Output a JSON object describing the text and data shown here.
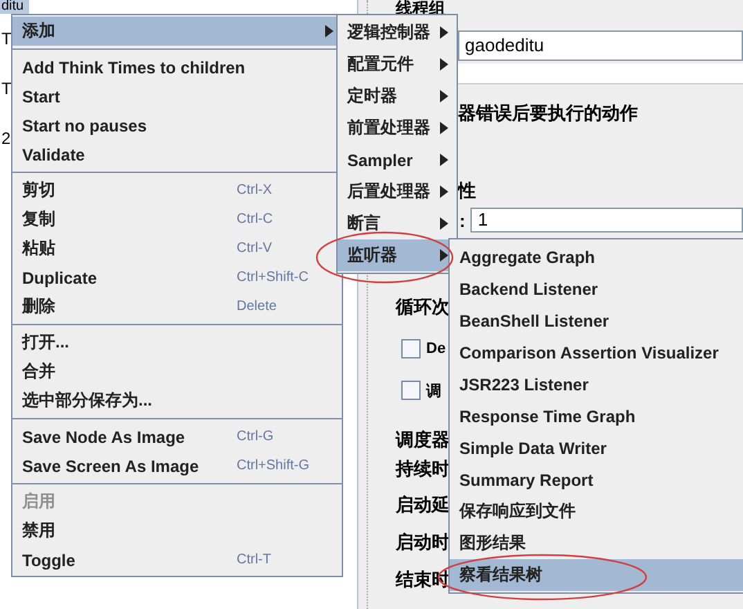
{
  "tree": {
    "top_fragment": "ditu",
    "fragments": [
      "T",
      "T",
      "2"
    ]
  },
  "panel": {
    "title": "线程组",
    "name_value": "gaodeditu",
    "error_section": "器错误后要执行的动作",
    "props_section": "性",
    "threads_label": ":",
    "threads_value": "1",
    "loop_label": "循环次",
    "checkboxes": [
      {
        "label": "De",
        "checked": false
      },
      {
        "label": "调",
        "checked": false
      }
    ],
    "scheduler_title": "调度器",
    "scheduler_labels": [
      "持续时",
      "启动延",
      "启动时",
      "结束时"
    ]
  },
  "context_menu": [
    {
      "kind": "item",
      "label": "添加",
      "submenu": true,
      "selected": true,
      "disabled": false
    },
    {
      "kind": "separator"
    },
    {
      "kind": "item",
      "label": "Add Think Times to children",
      "selected": false,
      "disabled": false
    },
    {
      "kind": "item",
      "label": "Start",
      "selected": false,
      "disabled": false
    },
    {
      "kind": "item",
      "label": "Start no pauses",
      "selected": false,
      "disabled": false
    },
    {
      "kind": "item",
      "label": "Validate",
      "selected": false,
      "disabled": false
    },
    {
      "kind": "separator"
    },
    {
      "kind": "item",
      "label": "剪切",
      "shortcut": "Ctrl-X",
      "selected": false,
      "disabled": false
    },
    {
      "kind": "item",
      "label": "复制",
      "shortcut": "Ctrl-C",
      "selected": false,
      "disabled": false
    },
    {
      "kind": "item",
      "label": "粘贴",
      "shortcut": "Ctrl-V",
      "selected": false,
      "disabled": false
    },
    {
      "kind": "item",
      "label": "Duplicate",
      "shortcut": "Ctrl+Shift-C",
      "selected": false,
      "disabled": false
    },
    {
      "kind": "item",
      "label": "删除",
      "shortcut": "Delete",
      "selected": false,
      "disabled": false
    },
    {
      "kind": "separator"
    },
    {
      "kind": "item",
      "label": "打开...",
      "selected": false,
      "disabled": false
    },
    {
      "kind": "item",
      "label": "合并",
      "selected": false,
      "disabled": false
    },
    {
      "kind": "item",
      "label": "选中部分保存为...",
      "selected": false,
      "disabled": false
    },
    {
      "kind": "separator"
    },
    {
      "kind": "item",
      "label": "Save Node As Image",
      "shortcut": "Ctrl-G",
      "selected": false,
      "disabled": false
    },
    {
      "kind": "item",
      "label": "Save Screen As Image",
      "shortcut": "Ctrl+Shift-G",
      "selected": false,
      "disabled": false
    },
    {
      "kind": "separator"
    },
    {
      "kind": "item",
      "label": "启用",
      "selected": false,
      "disabled": true
    },
    {
      "kind": "item",
      "label": "禁用",
      "selected": false,
      "disabled": false
    },
    {
      "kind": "item",
      "label": "Toggle",
      "shortcut": "Ctrl-T",
      "selected": false,
      "disabled": false
    }
  ],
  "add_submenu": [
    {
      "kind": "item",
      "label": "逻辑控制器",
      "submenu": true,
      "selected": false,
      "disabled": false
    },
    {
      "kind": "item",
      "label": "配置元件",
      "submenu": true,
      "selected": false,
      "disabled": false
    },
    {
      "kind": "item",
      "label": "定时器",
      "submenu": true,
      "selected": false,
      "disabled": false
    },
    {
      "kind": "item",
      "label": "前置处理器",
      "submenu": true,
      "selected": false,
      "disabled": false
    },
    {
      "kind": "item",
      "label": "Sampler",
      "submenu": true,
      "selected": false,
      "disabled": false
    },
    {
      "kind": "item",
      "label": "后置处理器",
      "submenu": true,
      "selected": false,
      "disabled": false
    },
    {
      "kind": "item",
      "label": "断言",
      "submenu": true,
      "selected": false,
      "disabled": false
    },
    {
      "kind": "item",
      "label": "监听器",
      "submenu": true,
      "selected": true,
      "disabled": false
    }
  ],
  "listener_submenu": [
    {
      "kind": "item",
      "label": "Aggregate Graph",
      "selected": false,
      "disabled": false
    },
    {
      "kind": "item",
      "label": "Backend Listener",
      "selected": false,
      "disabled": false
    },
    {
      "kind": "item",
      "label": "BeanShell Listener",
      "selected": false,
      "disabled": false
    },
    {
      "kind": "item",
      "label": "Comparison Assertion Visualizer",
      "selected": false,
      "disabled": false
    },
    {
      "kind": "item",
      "label": "JSR223 Listener",
      "selected": false,
      "disabled": false
    },
    {
      "kind": "item",
      "label": "Response Time Graph",
      "selected": false,
      "disabled": false
    },
    {
      "kind": "item",
      "label": "Simple Data Writer",
      "selected": false,
      "disabled": false
    },
    {
      "kind": "item",
      "label": "Summary Report",
      "selected": false,
      "disabled": false
    },
    {
      "kind": "item",
      "label": "保存响应到文件",
      "selected": false,
      "disabled": false
    },
    {
      "kind": "item",
      "label": "图形结果",
      "selected": false,
      "disabled": false
    },
    {
      "kind": "item",
      "label": "察看结果树",
      "selected": true,
      "disabled": false
    }
  ]
}
